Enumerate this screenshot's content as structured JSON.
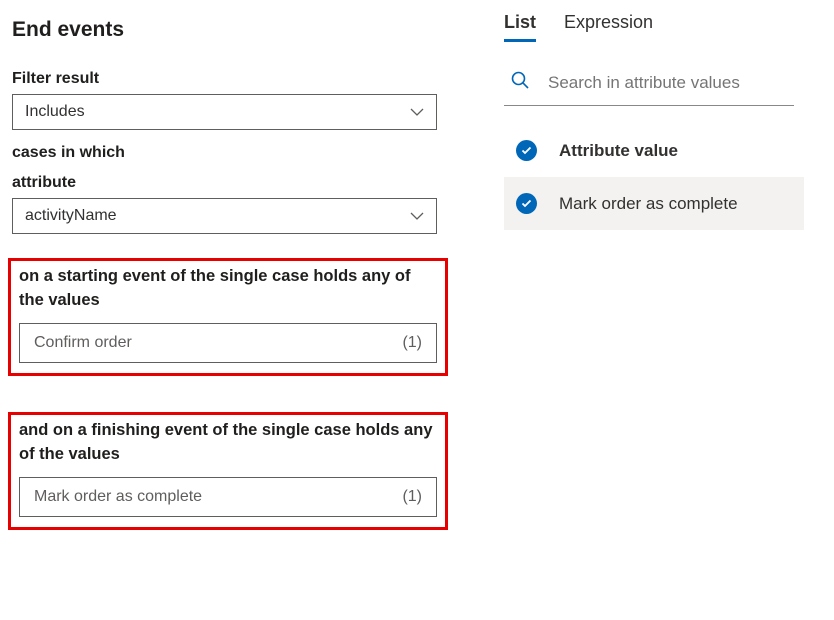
{
  "page_title": "End events",
  "filter_result": {
    "label": "Filter result",
    "value": "Includes"
  },
  "cases_label": "cases in which",
  "attribute": {
    "label": "attribute",
    "value": "activityName"
  },
  "starting": {
    "label": "on a starting event of the single case holds any of the values",
    "value": "Confirm order",
    "count": "(1)"
  },
  "finishing": {
    "label": "and on a finishing event of the single case holds any of the values",
    "value": "Mark order as complete",
    "count": "(1)"
  },
  "tabs": {
    "list": "List",
    "expression": "Expression"
  },
  "search": {
    "placeholder": "Search in attribute values"
  },
  "attr_header": "Attribute value",
  "attr_items": [
    {
      "label": "Mark order as complete"
    }
  ]
}
